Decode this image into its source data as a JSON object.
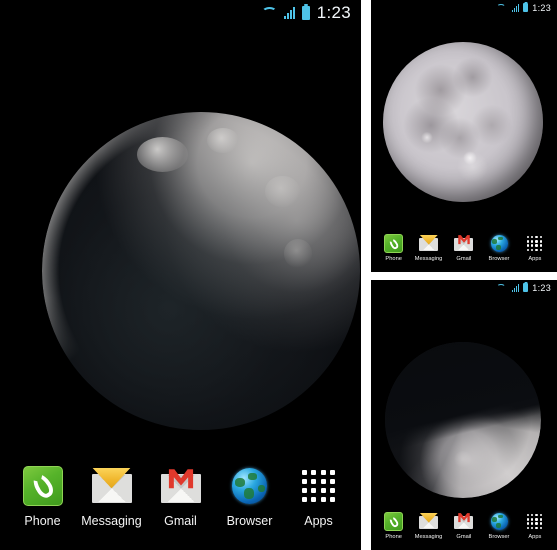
{
  "app": {
    "title": "Moon live wallpaper",
    "platform": "Android home screen"
  },
  "colors": {
    "status_icon": "#4ec3e8",
    "clock_text": "#f2f7fa",
    "dock_label": "#f4f4f4",
    "panel_background": "#000000",
    "gutter": "#ffffff",
    "phone_icon": "#56b32a",
    "messaging_icon": "#f0b62c",
    "gmail_icon": "#e0392c",
    "browser_icon": "#2aa8e0"
  },
  "statusbar": {
    "clock": "1:23",
    "icons": [
      "wifi-icon",
      "signal-icon",
      "battery-icon"
    ]
  },
  "dock": {
    "items": [
      {
        "label": "Phone",
        "icon": "phone-icon"
      },
      {
        "label": "Messaging",
        "icon": "messaging-envelope-icon"
      },
      {
        "label": "Gmail",
        "icon": "gmail-envelope-icon"
      },
      {
        "label": "Browser",
        "icon": "browser-globe-icon"
      },
      {
        "label": "Apps",
        "icon": "apps-grid-icon"
      }
    ]
  },
  "panels": {
    "main": {
      "name": "main-preview",
      "wallpaper": "waning-crescent-moon",
      "phase": "Waning crescent, lit limb upper-right"
    },
    "top_right": {
      "name": "secondary-preview-full-moon",
      "wallpaper": "full-moon",
      "phase": "Full moon with visible maria"
    },
    "bottom_right": {
      "name": "secondary-preview-half-moon",
      "wallpaper": "half-moon",
      "phase": "Half moon, lit limb lower-right"
    }
  }
}
